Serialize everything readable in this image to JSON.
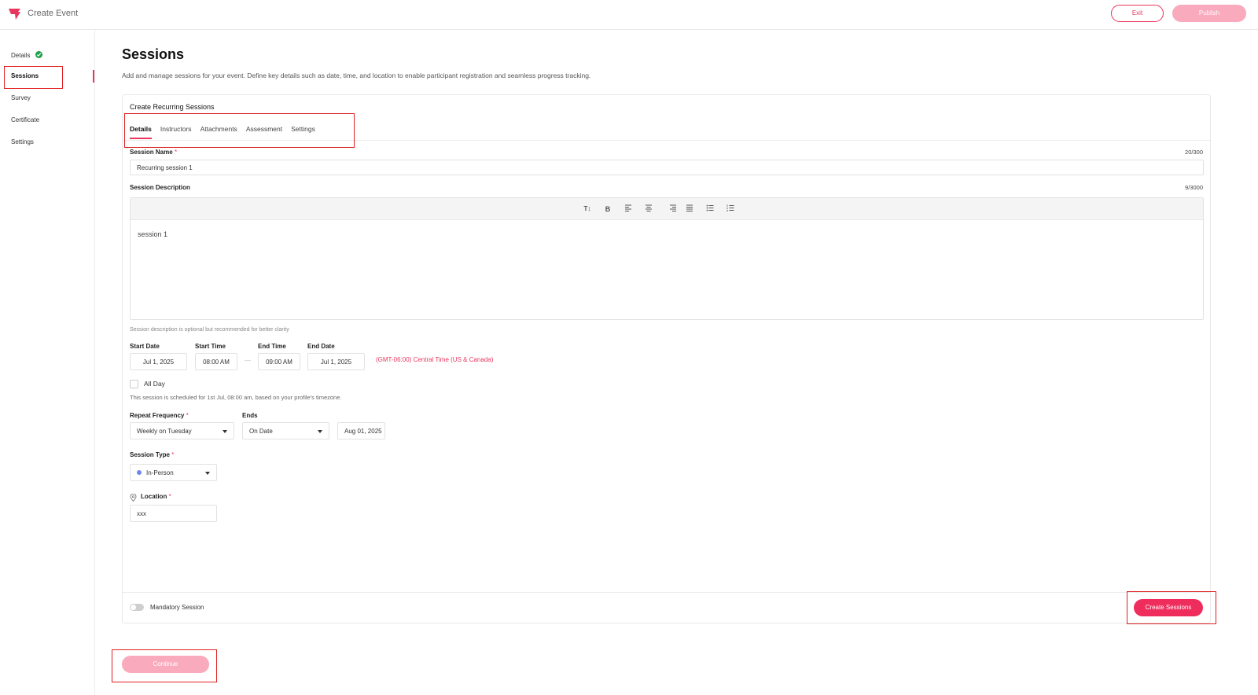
{
  "header": {
    "app_title": "Create Event",
    "exit_label": "Exit",
    "publish_label": "Publish"
  },
  "sidebar": {
    "items": [
      {
        "label": "Details",
        "status": "completed"
      },
      {
        "label": "Sessions",
        "status": "active"
      },
      {
        "label": "Survey"
      },
      {
        "label": "Certificate"
      },
      {
        "label": "Settings"
      }
    ]
  },
  "page": {
    "title": "Sessions",
    "description": "Add and manage sessions for your event. Define key details such as date, time, and location to enable participant registration and seamless progress tracking."
  },
  "card": {
    "title": "Create Recurring Sessions",
    "tabs": [
      {
        "label": "Details",
        "active": true
      },
      {
        "label": "Instructors"
      },
      {
        "label": "Attachments"
      },
      {
        "label": "Assessment"
      },
      {
        "label": "Settings"
      }
    ]
  },
  "form": {
    "session_name": {
      "label": "Session Name",
      "required": "*",
      "value": "Recurring session 1",
      "counter": "20/300"
    },
    "session_description": {
      "label": "Session Description",
      "counter": "9/3000",
      "value": "session 1",
      "hint": "Session description is optional but recommended for better clarity",
      "toolbar": [
        "text-size-icon",
        "bold-icon",
        "align-left-icon",
        "align-center-icon",
        "align-right-icon",
        "align-justify-icon",
        "bullet-list-icon",
        "numbered-list-icon"
      ]
    },
    "start_date": {
      "label": "Start Date",
      "value": "Jul 1, 2025"
    },
    "start_time": {
      "label": "Start Time",
      "value": "08:00 AM"
    },
    "end_time": {
      "label": "End Time",
      "value": "09:00 AM"
    },
    "end_date": {
      "label": "End Date",
      "value": "Jul 1, 2025"
    },
    "timezone": "(GMT-06:00) Central Time (US & Canada)",
    "all_day": {
      "label": "All Day",
      "checked": false
    },
    "schedule_note": "This session is scheduled for 1st Jul, 08:00 am, based on your profile's timezone.",
    "repeat_frequency": {
      "label": "Repeat Frequency",
      "required": "*",
      "value": "Weekly on Tuesday"
    },
    "ends": {
      "label": "Ends",
      "value": "On Date",
      "date": "Aug 01, 2025"
    },
    "session_type": {
      "label": "Session Type",
      "required": "*",
      "value": "In-Person",
      "dot_color": "#6f87e8"
    },
    "location": {
      "label": "Location",
      "required": "*",
      "value": "xxx"
    },
    "mandatory": {
      "label": "Mandatory Session",
      "enabled": false
    },
    "create_label": "Create Sessions"
  },
  "continue_label": "Continue",
  "colors": {
    "accent": "#ee2d5c",
    "accent_light": "#f9aabd",
    "success": "#1e9e4a",
    "highlight": "#e02020"
  }
}
